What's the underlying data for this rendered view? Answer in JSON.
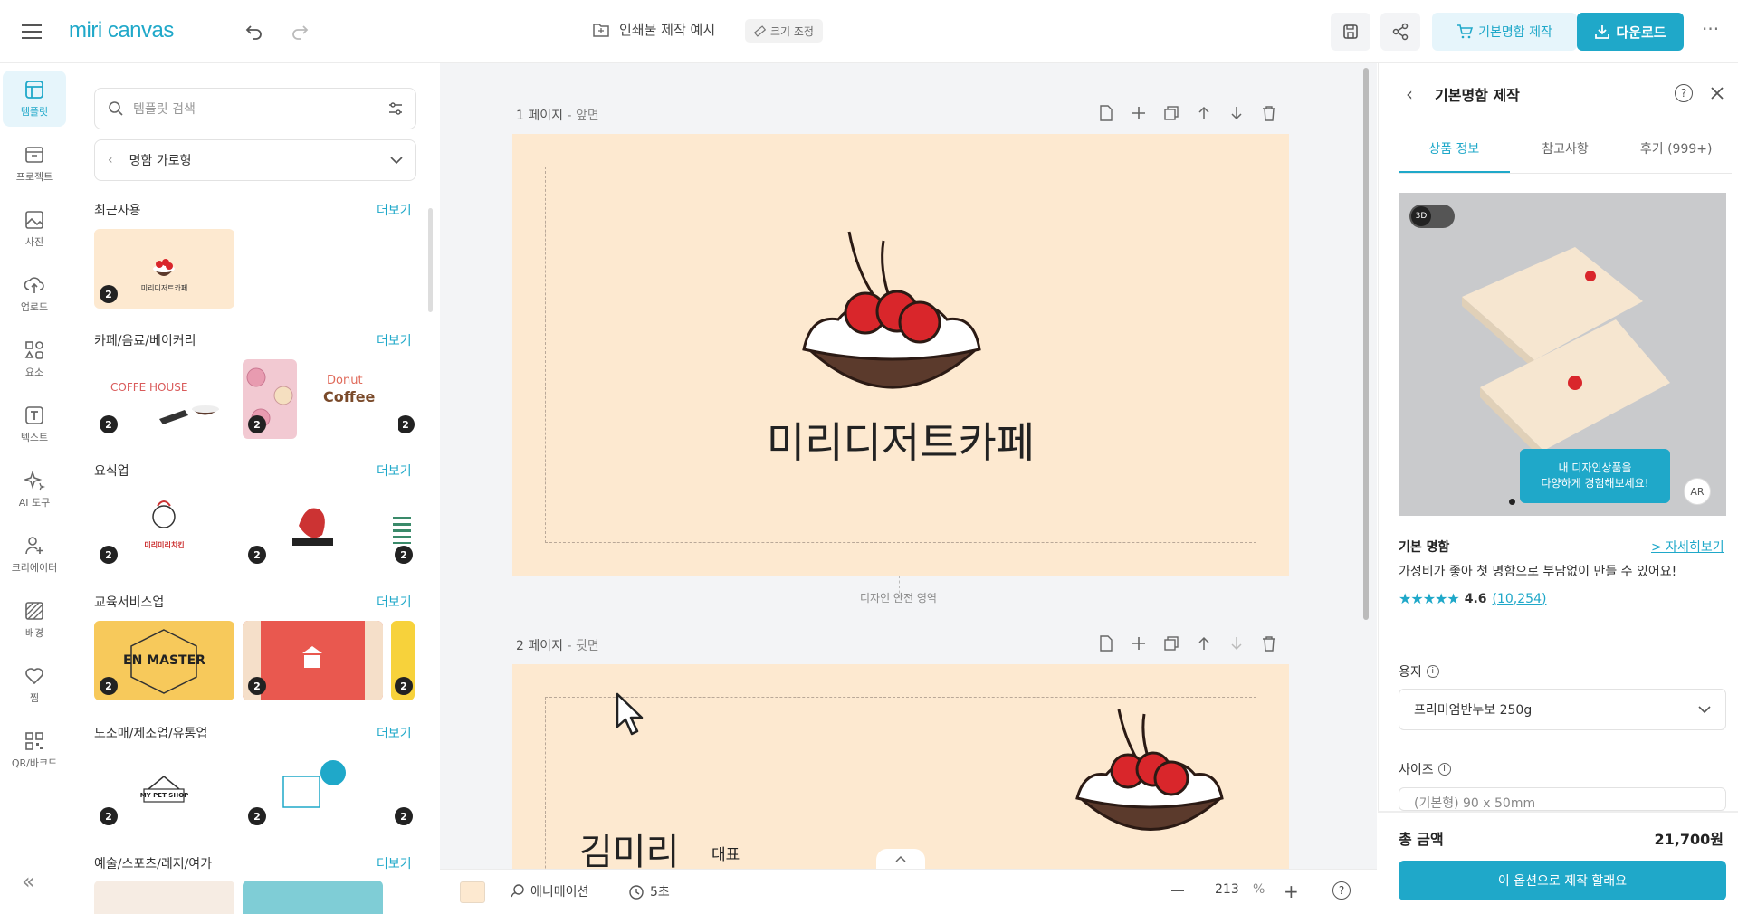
{
  "app": {
    "logo": "miri canvas"
  },
  "header": {
    "doc_title": "인쇄물 제작 예시",
    "resize_label": "크기 조정",
    "make_button": "기본명함 제작",
    "download_button": "다운로드",
    "more": "···"
  },
  "left_nav": {
    "items": [
      {
        "label": "템플릿",
        "icon": "template-icon"
      },
      {
        "label": "프로젝트",
        "icon": "project-icon"
      },
      {
        "label": "사진",
        "icon": "photo-icon"
      },
      {
        "label": "업로드",
        "icon": "upload-icon"
      },
      {
        "label": "요소",
        "icon": "elements-icon"
      },
      {
        "label": "텍스트",
        "icon": "text-icon"
      },
      {
        "label": "AI 도구",
        "icon": "ai-tool-icon"
      },
      {
        "label": "크리에이터",
        "icon": "creator-icon"
      },
      {
        "label": "배경",
        "icon": "background-icon"
      },
      {
        "label": "찜",
        "icon": "heart-icon"
      },
      {
        "label": "QR/바코드",
        "icon": "qr-icon"
      }
    ],
    "collapse": "«"
  },
  "template_panel": {
    "search_placeholder": "템플릿 검색",
    "category": "명함 가로형",
    "more_label": "더보기",
    "sections": [
      {
        "title": "최근사용"
      },
      {
        "title": "카페/음료/베이커리"
      },
      {
        "title": "요식업"
      },
      {
        "title": "교육서비스업"
      },
      {
        "title": "도소매/제조업/유통업"
      },
      {
        "title": "예술/스포츠/레저/여가"
      }
    ],
    "badge": "2",
    "thumb_texts": {
      "recent": "미리디저트카페",
      "coffee_house": "COFFE HOUSE",
      "donut": "Donut",
      "coffee": "Coffee",
      "chicken": "미리미리치킨",
      "en_master": "EN MASTER",
      "pet_shop": "MY PET SHOP"
    }
  },
  "canvas": {
    "page1_label": "1 페이지",
    "page1_side": "- 앞면",
    "page2_label": "2 페이지",
    "page2_side": "- 뒷면",
    "card_title": "미리디저트카페",
    "safe_area": "디자인 안전 영역",
    "back_name": "김미리",
    "back_role": "대표"
  },
  "bottom_bar": {
    "animation": "애니메이션",
    "duration": "5초",
    "zoom": "213",
    "zoom_unit": "%",
    "help": "?"
  },
  "right_panel": {
    "title": "기본명함 제작",
    "tabs": [
      "상품 정보",
      "참고사항",
      "후기 (999+)"
    ],
    "three_d": "3D",
    "tooltip_line1": "내 디자인상품을",
    "tooltip_line2": "다양하게 경험해보세요!",
    "ar": "AR",
    "product_name": "기본 명함",
    "detail_link": "> 자세히보기",
    "description": "가성비가 좋아 첫 명함으로 부담없이 만들 수 있어요!",
    "rating": "4.6",
    "review_count": "(10,254)",
    "paper_label": "용지",
    "paper_value": "프리미엄반누보 250g",
    "size_label": "사이즈",
    "size_value": "(기본형) 90 x 50mm",
    "total_label": "총 금액",
    "total_value": "21,700원",
    "cta": "이 옵션으로 제작 할래요"
  },
  "colors": {
    "accent": "#1fa8c9",
    "card_bg": "#fde9d0",
    "cherry": "#d9262b",
    "tart": "#5b3a2c"
  }
}
